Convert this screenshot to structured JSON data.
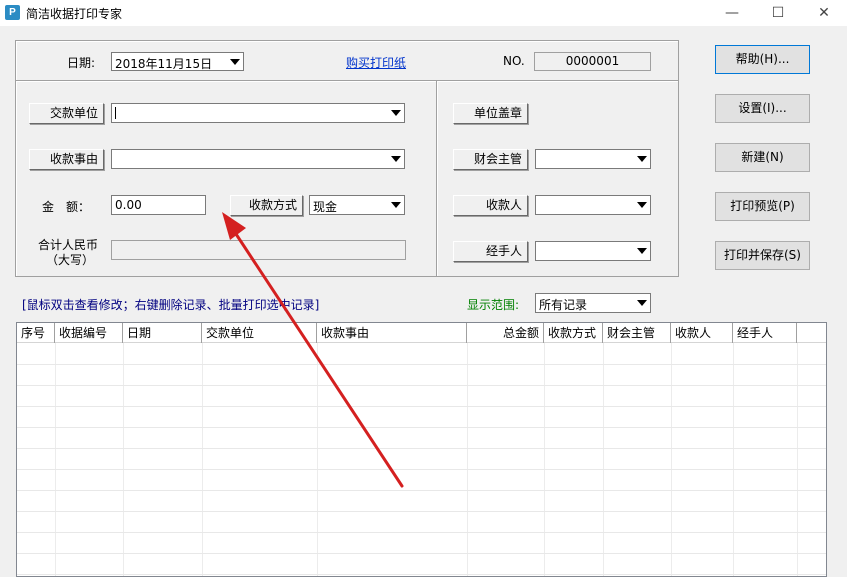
{
  "window": {
    "title": "简洁收据打印专家",
    "icon_letter": "P",
    "controls": [
      "minimize-icon",
      "maximize-icon",
      "close-icon"
    ]
  },
  "form": {
    "date_label": "日期:",
    "date_value": "2018年11月15日",
    "buy_paper_link": "购买打印纸",
    "no_label": "NO.",
    "no_value": "0000001",
    "payer_label": "交款单位",
    "payer_value": "",
    "reason_label": "收款事由",
    "reason_value": "",
    "amount_label": "金　额：",
    "amount_value": "0.00",
    "payment_method_label": "收款方式",
    "payment_method_value": "现金",
    "rmb_caps_label_1": "合计人民币",
    "rmb_caps_label_2": "（大写）",
    "rmb_caps_value": "",
    "seal_label": "单位盖章",
    "accountant_label": "财会主管",
    "payee_label": "收款人",
    "handler_label": "经手人"
  },
  "side_buttons": {
    "help": "帮助(H)...",
    "settings": "设置(I)...",
    "new": "新建(N)",
    "print_preview": "打印预览(P)",
    "print_save": "打印并保存(S)"
  },
  "list": {
    "hint": "[鼠标双击查看修改；右键删除记录、批量打印选中记录]",
    "range_label": "显示范围:",
    "range_value": "所有记录",
    "columns": [
      "序号",
      "收据编号",
      "日期",
      "交款单位",
      "收款事由",
      "总金额",
      "收款方式",
      "财会主管",
      "收款人",
      "经手人"
    ]
  },
  "colors": {
    "link": "#0033cc",
    "hint": "#000080",
    "range_label": "#008000",
    "arrow": "#d42020"
  }
}
